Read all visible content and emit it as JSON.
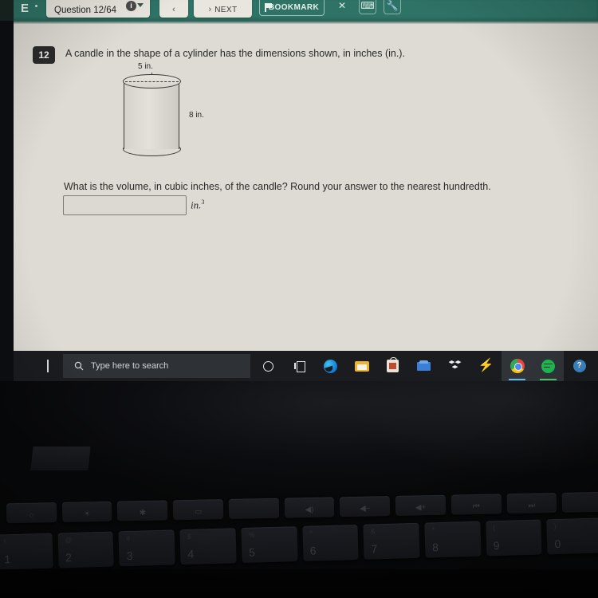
{
  "app": {
    "logo": "E",
    "question_counter": "Question 12/64",
    "info_icon_glyph": "i",
    "prev_label": "",
    "prev_arrow": "‹",
    "next_label": "NEXT",
    "next_arrow": "›",
    "bookmark_label": "BOOKMARK",
    "close_glyph": "✕",
    "calculator_glyph": "⌨",
    "tools_glyph": "🔧",
    "header_color": "#2f7366",
    "content_bg": "#dedbd4"
  },
  "question": {
    "number": "12",
    "stem": "A candle in the shape of a cylinder has the dimensions shown, in inches (in.).",
    "prompt": "What is the volume, in cubic inches, of the candle? Round your answer to the nearest hundredth.",
    "answer_value": "",
    "answer_placeholder": "",
    "unit_text": "in.",
    "unit_exponent": "3",
    "figure": {
      "shape": "cylinder",
      "diameter_label": "5 in.",
      "height_label": "8 in."
    }
  },
  "taskbar": {
    "search_placeholder": "Type here to search",
    "items": [
      {
        "name": "cortana",
        "label": "Cortana"
      },
      {
        "name": "task-view",
        "label": "Task View"
      },
      {
        "name": "edge",
        "label": "Microsoft Edge"
      },
      {
        "name": "file-explorer",
        "label": "File Explorer"
      },
      {
        "name": "microsoft-store",
        "label": "Microsoft Store"
      },
      {
        "name": "teams",
        "label": "Microsoft Teams"
      },
      {
        "name": "dropbox",
        "label": "Dropbox"
      },
      {
        "name": "bolt",
        "label": "Lightning app"
      },
      {
        "name": "chrome",
        "label": "Google Chrome"
      },
      {
        "name": "spotify",
        "label": "Spotify"
      },
      {
        "name": "help",
        "label": "Get Help"
      }
    ],
    "tray_chevron": "∧",
    "help_glyph": "?"
  },
  "keyboard": {
    "function_row": [
      "☼",
      "☀",
      "✱",
      "▭",
      "",
      "◀̵)",
      "◀−",
      "◀+",
      "⏮",
      "⏭",
      ""
    ],
    "number_row_main": [
      "1",
      "2",
      "3",
      "4",
      "5",
      "6",
      "7",
      "8",
      "9",
      "0"
    ],
    "number_row_shift": [
      "!",
      "@",
      "#",
      "$",
      "%",
      "^",
      "&",
      "*",
      "(",
      ")"
    ]
  }
}
